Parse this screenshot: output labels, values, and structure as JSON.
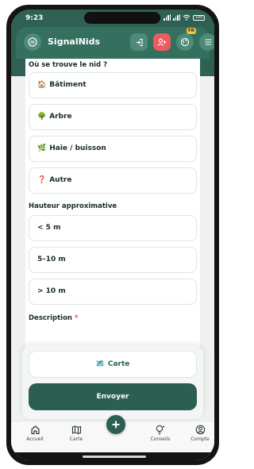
{
  "status_bar": {
    "time": "9:23",
    "battery": "100"
  },
  "header": {
    "app_name": "SignalNids",
    "language_badge": "FR"
  },
  "form": {
    "location_label": "Où se trouve le nid ?",
    "locations": [
      {
        "emoji": "🏠",
        "label": "Bâtiment"
      },
      {
        "emoji": "🌳",
        "label": "Arbre"
      },
      {
        "emoji": "🌿",
        "label": "Haie / buisson"
      },
      {
        "emoji": "❓",
        "label": "Autre"
      }
    ],
    "height_label": "Hauteur approximative",
    "heights": [
      "< 5 m",
      "5–10 m",
      "> 10 m"
    ],
    "description_label": "Description",
    "required_marker": "*"
  },
  "actions": {
    "map_emoji": "🗺️",
    "map_label": "Carte",
    "submit_label": "Envoyer"
  },
  "tabbar": {
    "items": [
      {
        "icon": "home-icon",
        "label": "Accueil"
      },
      {
        "icon": "map-icon",
        "label": "Carte"
      },
      {
        "icon": "add-icon",
        "label": ""
      },
      {
        "icon": "lightbulb-icon",
        "label": "Conseils"
      },
      {
        "icon": "account-icon",
        "label": "Compte"
      }
    ]
  },
  "colors": {
    "primary": "#2e6153",
    "accent_red": "#ee5a62",
    "badge_yellow": "#f2c63a",
    "required": "#e8474f"
  }
}
